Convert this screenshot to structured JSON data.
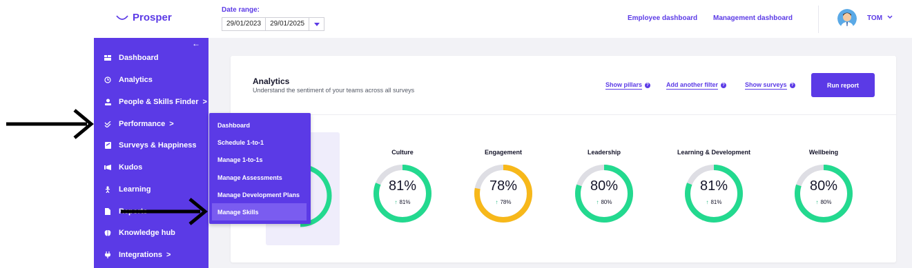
{
  "brand": {
    "name": "Prosper",
    "color": "#5b3ae6"
  },
  "header": {
    "date_label": "Date range:",
    "date_from": "29/01/2023",
    "date_to": "29/01/2025",
    "links": [
      "Employee dashboard",
      "Management dashboard"
    ],
    "user": "TOM"
  },
  "sidebar": {
    "collapse_icon": "arrow-left-icon",
    "items": [
      {
        "label": "Dashboard",
        "icon": "dashboard-icon"
      },
      {
        "label": "Analytics",
        "icon": "clock-icon"
      },
      {
        "label": "People & Skills Finder",
        "icon": "person-icon",
        "chevron": ">"
      },
      {
        "label": "Performance",
        "icon": "performance-icon",
        "chevron": ">"
      },
      {
        "label": "Surveys & Happiness",
        "icon": "survey-icon"
      },
      {
        "label": "Kudos",
        "icon": "kudos-icon"
      },
      {
        "label": "Learning",
        "icon": "learning-icon"
      },
      {
        "label": "Reports",
        "icon": "report-icon"
      },
      {
        "label": "Knowledge hub",
        "icon": "brain-icon"
      },
      {
        "label": "Integrations",
        "icon": "plug-icon",
        "chevron": ">"
      }
    ]
  },
  "submenu": {
    "items": [
      "Dashboard",
      "Schedule 1-to-1",
      "Manage 1-to-1s",
      "Manage Assessments",
      "Manage Development Plans",
      "Manage Skills"
    ],
    "active": "Manage Skills"
  },
  "analytics": {
    "title": "Analytics",
    "subtitle": "Understand the sentiment of your teams across all surveys",
    "filters": [
      "Show pillars",
      "Add another filter",
      "Show surveys"
    ],
    "run_label": "Run report",
    "pillars": [
      {
        "name": "Culture",
        "value": "81%",
        "trend": "81%",
        "fraction": 0.81,
        "color": "#23d98f"
      },
      {
        "name": "Engagement",
        "value": "78%",
        "trend": "78%",
        "fraction": 0.78,
        "color": "#f7b81a"
      },
      {
        "name": "Leadership",
        "value": "80%",
        "trend": "80%",
        "fraction": 0.8,
        "color": "#23d98f"
      },
      {
        "name": "Learning & Development",
        "value": "81%",
        "trend": "81%",
        "fraction": 0.81,
        "color": "#23d98f"
      },
      {
        "name": "Wellbeing",
        "value": "80%",
        "trend": "80%",
        "fraction": 0.8,
        "color": "#23d98f"
      }
    ]
  }
}
